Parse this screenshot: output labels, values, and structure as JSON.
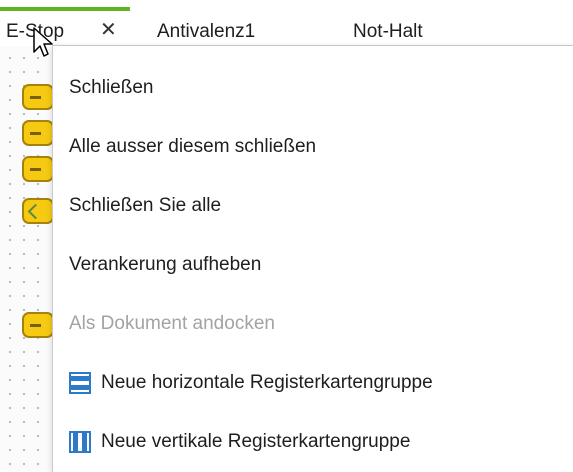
{
  "tabs": [
    {
      "label": "E-Stop",
      "active": true,
      "close_glyph": "✕"
    },
    {
      "label": "Antivalenz1",
      "active": false
    },
    {
      "label": "Not-Halt",
      "active": false
    }
  ],
  "accent_color": "#5bb525",
  "context_menu": {
    "items": [
      {
        "label": "Schließen",
        "enabled": true
      },
      {
        "label": "Alle ausser diesem schließen",
        "enabled": true
      },
      {
        "label": "Schließen Sie alle",
        "enabled": true
      },
      {
        "label": "Verankerung aufheben",
        "enabled": true
      },
      {
        "label": "Als Dokument andocken",
        "enabled": false
      },
      {
        "label": "Neue horizontale Registerkartengruppe",
        "enabled": true,
        "icon": "horizontal-tab-group-icon"
      },
      {
        "label": "Neue vertikale Registerkartengruppe",
        "enabled": true,
        "icon": "vertical-tab-group-icon"
      }
    ]
  }
}
